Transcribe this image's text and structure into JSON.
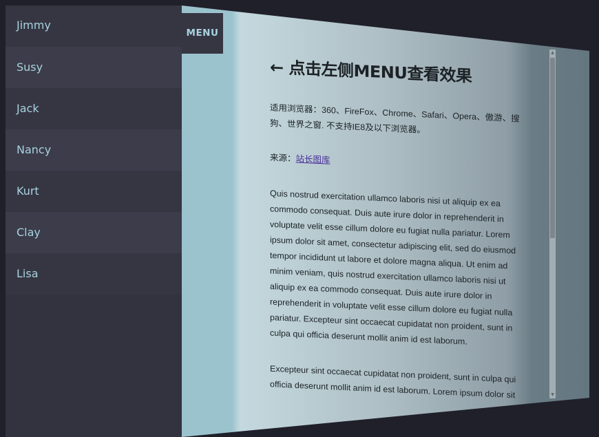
{
  "menu_button": {
    "label": "MENU"
  },
  "sidebar": {
    "items": [
      {
        "label": "Jimmy"
      },
      {
        "label": "Susy"
      },
      {
        "label": "Jack"
      },
      {
        "label": "Nancy"
      },
      {
        "label": "Kurt"
      },
      {
        "label": "Clay"
      },
      {
        "label": "Lisa"
      }
    ]
  },
  "main": {
    "title": "← 点击左侧MENU查看效果",
    "browsers_text": "适用浏览器：360、FireFox、Chrome、Safari、Opera、傲游、搜狗、世界之窗. 不支持IE8及以下浏览器。",
    "source_label": "来源：",
    "source_link": "站长图库",
    "paragraph_1": "Quis nostrud exercitation ullamco laboris nisi ut aliquip ex ea commodo consequat. Duis aute irure dolor in reprehenderit in voluptate velit esse cillum dolore eu fugiat nulla pariatur. Lorem ipsum dolor sit amet, consectetur adipiscing elit, sed do eiusmod tempor incididunt ut labore et dolore magna aliqua. Ut enim ad minim veniam, quis nostrud exercitation ullamco laboris nisi ut aliquip ex ea commodo consequat. Duis aute irure dolor in reprehenderit in voluptate velit esse cillum dolore eu fugiat nulla pariatur. Excepteur sint occaecat cupidatat non proident, sunt in culpa qui officia deserunt mollit anim id est laborum.",
    "paragraph_2": "Excepteur sint occaecat cupidatat non proident, sunt in culpa qui officia deserunt mollit anim id est laborum. Lorem ipsum dolor sit"
  },
  "colors": {
    "background": "#20202a",
    "sidebar": "#33333f",
    "sidebar_text": "#a8d2df",
    "page_left": "#9bc3ce",
    "link": "#4a2e9a"
  },
  "icons": {
    "scroll_up": "scroll-up-arrow-icon",
    "scroll_down": "scroll-down-arrow-icon"
  }
}
